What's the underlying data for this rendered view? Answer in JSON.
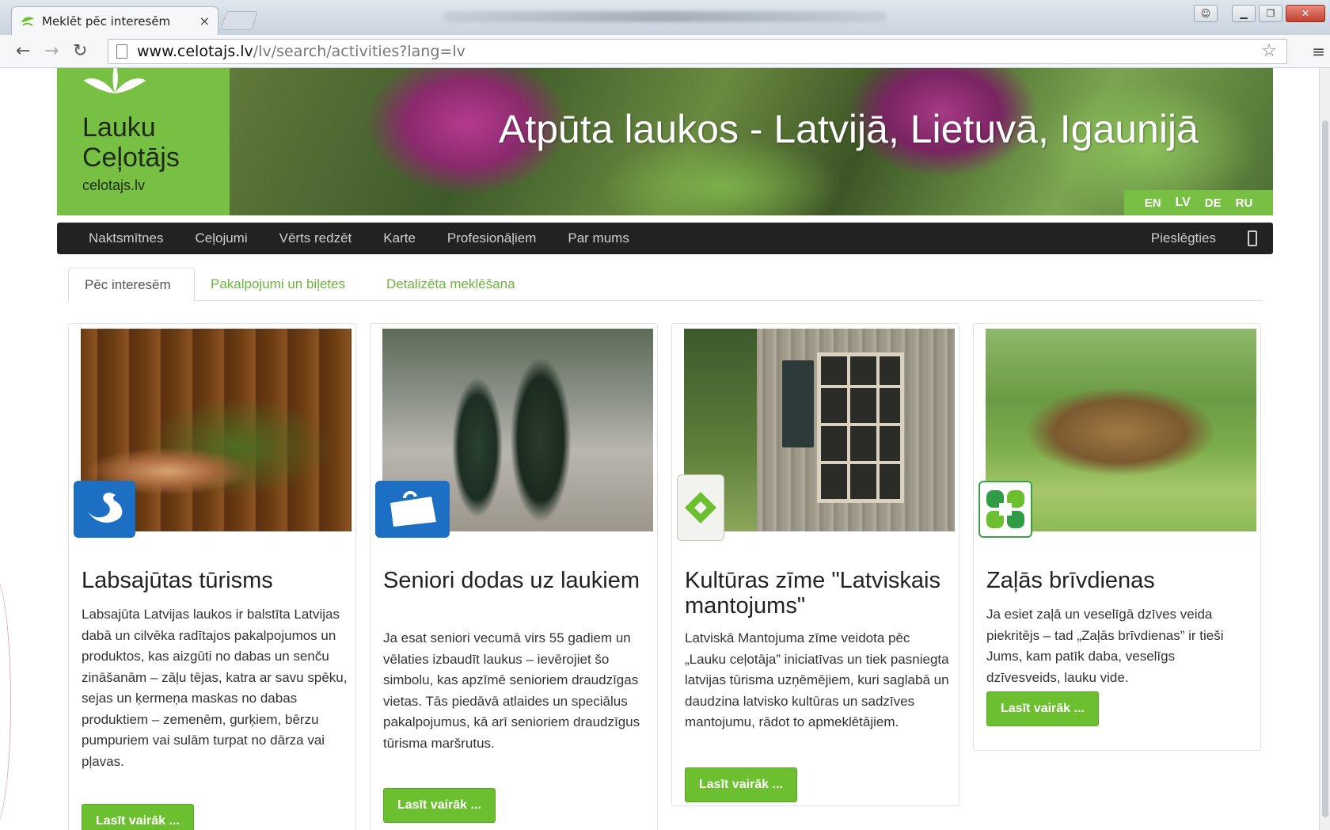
{
  "browser": {
    "tab_title": "Meklēt pēc interesēm",
    "tab_close": "×",
    "url_host": "www.celotajs.lv",
    "url_path": "/lv/search/activities?lang=lv"
  },
  "banner": {
    "logo_line1": "Lauku",
    "logo_line2": "Ceļotājs",
    "logo_domain": "celotajs.lv",
    "title": "Atpūta laukos - Latvijā, Lietuvā, Igaunijā",
    "languages": [
      "EN",
      "LV",
      "DE",
      "RU"
    ],
    "active_language": "LV"
  },
  "nav": {
    "items": [
      "Naktsmītnes",
      "Ceļojumi",
      "Vērts redzēt",
      "Karte",
      "Profesionāļiem",
      "Par mums"
    ],
    "login": "Pieslēgties"
  },
  "tabs": {
    "active": "Pēc interesēm",
    "others": [
      "Pakalpojumi un biļetes",
      "Detalizēta meklēšana"
    ]
  },
  "cards": [
    {
      "title": "Labsajūtas tūrisms",
      "text": "Labsajūta Latvijas laukos ir balstīta Latvijas dabā un cilvēka radītajos pakalpojumos un produktos, kas aizgūti no dabas un senču zināšanām – zāļu tējas, katra ar savu spēku, sejas un ķermeņa maskas no dabas produktiem – zemenēm, gurķiem, bērzu pumpuriem vai sulām turpat no dārza vai pļavas.",
      "button": "Lasīt vairāk ..."
    },
    {
      "title": "Seniori dodas uz laukiem",
      "text": "Ja esat seniori vecumā virs 55 gadiem un vēlaties izbaudīt laukus – ievērojiet šo simbolu, kas apzīmē senioriem draudzīgas vietas. Tās piedāvā atlaides un speciālus pakalpojumus, kā arī senioriem draudzīgus tūrisma maršrutus.",
      "button": "Lasīt vairāk ..."
    },
    {
      "title": "Kultūras zīme \"Latviskais mantojums\"",
      "text": "Latviskā Mantojuma zīme veidota pēc „Lauku ceļotāja” iniciatīvas un tiek pasniegta latvijas tūrisma uzņēmējiem, kuri saglabā un daudzina latvisko kultūras un sadzīves mantojumu, rādot to apmeklētājiem.",
      "button": "Lasīt vairāk ..."
    },
    {
      "title": "Zaļās brīvdienas",
      "text": "Ja esiet zaļā un veselīgā dzīves veida piekritējs – tad „Zaļās brīvdienas” ir tieši Jums, kam patīk daba, veselīgs dzīvesveids, lauku vide.",
      "button": "Lasīt vairāk ..."
    }
  ],
  "colors": {
    "brand_green": "#77c043",
    "button_green": "#6cc030",
    "nav_bg": "#222222",
    "tab_link": "#6db33f"
  }
}
